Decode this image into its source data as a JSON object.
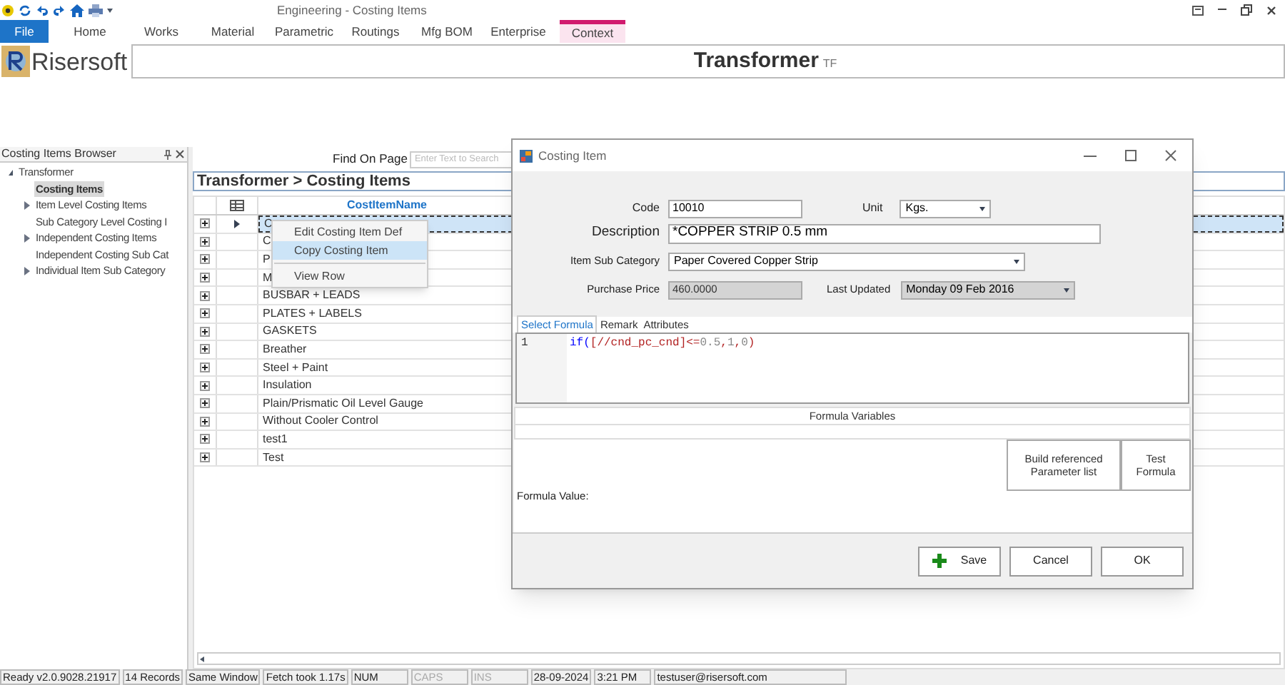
{
  "window": {
    "title": "Engineering - Costing Items"
  },
  "ribbon_tabs": [
    {
      "label": "File",
      "kind": "file"
    },
    {
      "label": "Home",
      "kind": "normal"
    },
    {
      "label": "Works",
      "kind": "normal"
    },
    {
      "label": "Material",
      "kind": "normal"
    },
    {
      "label": "Parametric",
      "kind": "normal"
    },
    {
      "label": "Routings",
      "kind": "normal"
    },
    {
      "label": "Mfg BOM",
      "kind": "normal"
    },
    {
      "label": "Enterprise",
      "kind": "normal"
    },
    {
      "label": "Context",
      "kind": "context"
    }
  ],
  "brand": "Risersoft",
  "page_heading": {
    "title": "Transformer",
    "suffix": "TF"
  },
  "browser": {
    "title": "Costing Items Browser",
    "tree": [
      {
        "label": "Transformer",
        "expanded": true,
        "selected": false,
        "children": [
          {
            "label": "Costing Items",
            "selected": true
          },
          {
            "label": "Item Level Costing Items",
            "expanded": false,
            "selected": false
          },
          {
            "label": "Sub Category Level Costing I",
            "selected": false
          },
          {
            "label": "Independent Costing Items",
            "expanded": false,
            "selected": false
          },
          {
            "label": "Independent Costing Sub Cat",
            "selected": false
          },
          {
            "label": "Individual Item Sub Category",
            "expanded": false,
            "selected": false
          }
        ]
      }
    ]
  },
  "find": {
    "label": "Find On Page",
    "placeholder": "Enter Text to Search"
  },
  "breadcrumb": "Transformer > Costing Items",
  "table": {
    "columns": [
      "CostItemName"
    ],
    "rows": [
      {
        "name": "C",
        "current": true
      },
      {
        "name": "C",
        "current": false
      },
      {
        "name": "P",
        "current": false
      },
      {
        "name": "M",
        "current": false
      },
      {
        "name": "BUSBAR + LEADS",
        "current": false
      },
      {
        "name": "PLATES + LABELS",
        "current": false
      },
      {
        "name": "GASKETS",
        "current": false
      },
      {
        "name": "Breather",
        "current": false
      },
      {
        "name": "Steel + Paint",
        "current": false
      },
      {
        "name": "Insulation",
        "current": false
      },
      {
        "name": "Plain/Prismatic Oil Level Gauge",
        "current": false
      },
      {
        "name": "Without Cooler Control",
        "current": false
      },
      {
        "name": "test1",
        "current": false
      },
      {
        "name": "Test",
        "current": false
      }
    ]
  },
  "context_menu": [
    {
      "label": "Edit Costing Item Def",
      "selected": false
    },
    {
      "label": "Copy Costing Item",
      "selected": true
    },
    {
      "label": "View Row",
      "selected": false
    }
  ],
  "dialog": {
    "title": "Costing Item",
    "code": {
      "label": "Code",
      "value": "10010"
    },
    "unit": {
      "label": "Unit",
      "value": "Kgs."
    },
    "description": {
      "label": "Description",
      "value": "*COPPER STRIP 0.5 mm"
    },
    "sub_category": {
      "label": "Item Sub Category",
      "value": "Paper Covered Copper Strip"
    },
    "purchase_price": {
      "label": "Purchase Price",
      "value": "460.0000"
    },
    "last_updated": {
      "label": "Last Updated",
      "value": "Monday 09 Feb 2016"
    },
    "tabs": [
      {
        "label": "Select Formula",
        "selected": true
      },
      {
        "label": "Remark",
        "selected": false
      },
      {
        "label": "Attributes",
        "selected": false
      }
    ],
    "formula": {
      "line_number": "1",
      "tokens": [
        {
          "text": "if(",
          "kind": "keyword"
        },
        {
          "text": "[//cnd_pc_cnd]<=",
          "kind": "reference"
        },
        {
          "text": "0.5",
          "kind": "number"
        },
        {
          "text": ",",
          "kind": "reference"
        },
        {
          "text": "1",
          "kind": "number"
        },
        {
          "text": ",",
          "kind": "reference"
        },
        {
          "text": "0",
          "kind": "number"
        },
        {
          "text": ")",
          "kind": "reference"
        }
      ]
    },
    "variables_heading": "Formula Variables",
    "build_button": "Build referenced Parameter list",
    "test_button": "Test Formula",
    "formula_value_label": "Formula Value:",
    "buttons": [
      {
        "label": "Save",
        "kind": "save"
      },
      {
        "label": "Cancel",
        "kind": "plain"
      },
      {
        "label": "OK",
        "kind": "plain"
      }
    ]
  },
  "status_bar": [
    {
      "text": "Ready v2.0.9028.21917",
      "disabled": false
    },
    {
      "text": "14 Records",
      "disabled": false
    },
    {
      "text": "Same Window",
      "disabled": false
    },
    {
      "text": "Fetch took 1.17s",
      "disabled": false
    },
    {
      "text": "NUM",
      "disabled": false
    },
    {
      "text": "CAPS",
      "disabled": true
    },
    {
      "text": "INS",
      "disabled": true
    },
    {
      "text": "28-09-2024",
      "disabled": false
    },
    {
      "text": "3:21 PM",
      "disabled": false
    },
    {
      "text": "testuser@risersoft.com",
      "disabled": false
    }
  ]
}
